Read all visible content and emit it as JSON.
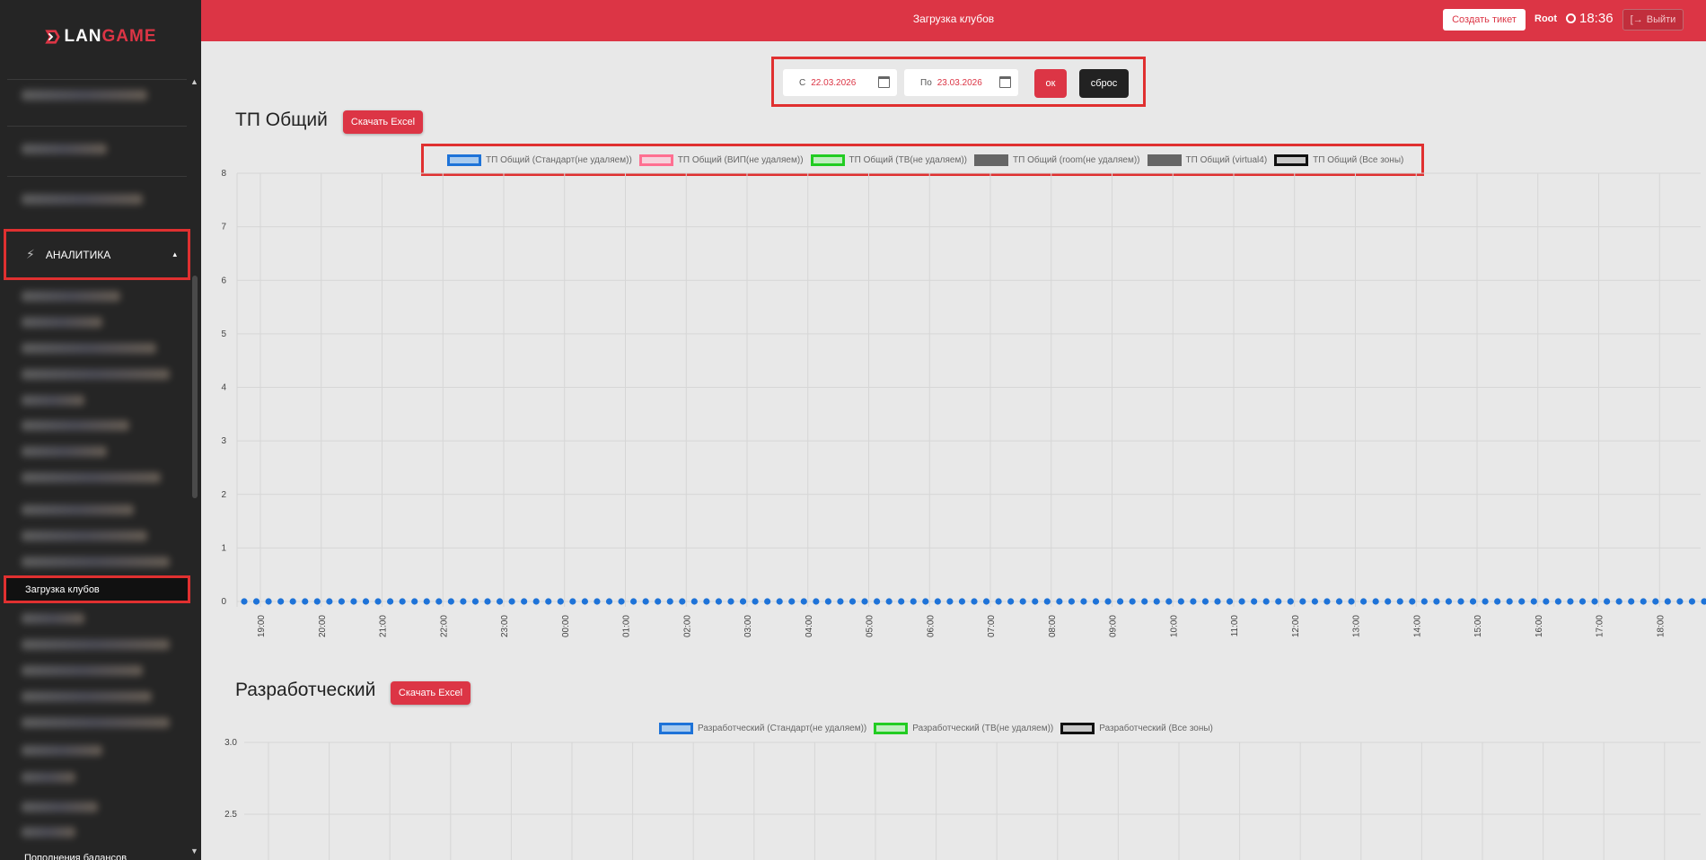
{
  "app": {
    "logo_lan": "LAN",
    "logo_game": "GAME"
  },
  "header": {
    "title": "Загрузка клубов",
    "create_ticket": "Создать тикет",
    "user": "Root",
    "time": "18:36",
    "logout": "Выйти"
  },
  "sidebar": {
    "analytics_label": "АНАЛИТИКА",
    "active_item": "Загрузка клубов",
    "bottom_item": "Пополнения балансов"
  },
  "filter": {
    "from_label": "С",
    "from_value": "22.03.2026",
    "to_label": "По",
    "to_value": "23.03.2026",
    "ok": "ок",
    "reset": "сброс"
  },
  "sections": [
    {
      "title": "ТП Общий",
      "excel": "Скачать Excel",
      "legend": [
        {
          "name": "ТП Общий (Стандарт(не удаляем))",
          "border": "#1e73d8",
          "fill": "#a9cbee"
        },
        {
          "name": "ТП Общий (ВИП(не удаляем))",
          "border": "#ff6f91",
          "fill": "#f6d2dc"
        },
        {
          "name": "ТП Общий (ТВ(не удаляем))",
          "border": "#22cc22",
          "fill": "#bfeebf"
        },
        {
          "name": "ТП Общий (room(не удаляем))",
          "border": "#666666",
          "fill": "#666666"
        },
        {
          "name": "ТП Общий (virtual4)",
          "border": "#666666",
          "fill": "#666666"
        },
        {
          "name": "ТП Общий (Все зоны)",
          "border": "#111111",
          "fill": "#c8c8c8"
        }
      ]
    },
    {
      "title": "Разработческий",
      "excel": "Скачать Excel",
      "legend": [
        {
          "name": "Разработческий (Стандарт(не удаляем))",
          "border": "#1e73d8",
          "fill": "#a9cbee"
        },
        {
          "name": "Разработческий (ТВ(не удаляем))",
          "border": "#22cc22",
          "fill": "#bfeebf"
        },
        {
          "name": "Разработческий (Все зоны)",
          "border": "#111111",
          "fill": "#c8c8c8"
        }
      ]
    }
  ],
  "chart_data": [
    {
      "type": "line",
      "ylim": [
        0,
        8
      ],
      "yticks": [
        "0",
        "1",
        "2",
        "3",
        "4",
        "5",
        "6",
        "7",
        "8"
      ],
      "x_ticks": [
        "19:00",
        "20:00",
        "21:00",
        "22:00",
        "23:00",
        "00:00",
        "01:00",
        "02:00",
        "03:00",
        "04:00",
        "05:00",
        "06:00",
        "07:00",
        "08:00",
        "09:00",
        "10:00",
        "11:00",
        "12:00",
        "13:00",
        "14:00",
        "15:00",
        "16:00",
        "17:00",
        "18:00"
      ],
      "points_per_hour": 5,
      "series": [
        {
          "name": "ТП Общий (Стандарт(не удаляем))",
          "color": "#1e73d8",
          "constant_value": 0
        }
      ]
    },
    {
      "type": "line",
      "yticks": [
        "3.0",
        "2.5"
      ]
    }
  ]
}
